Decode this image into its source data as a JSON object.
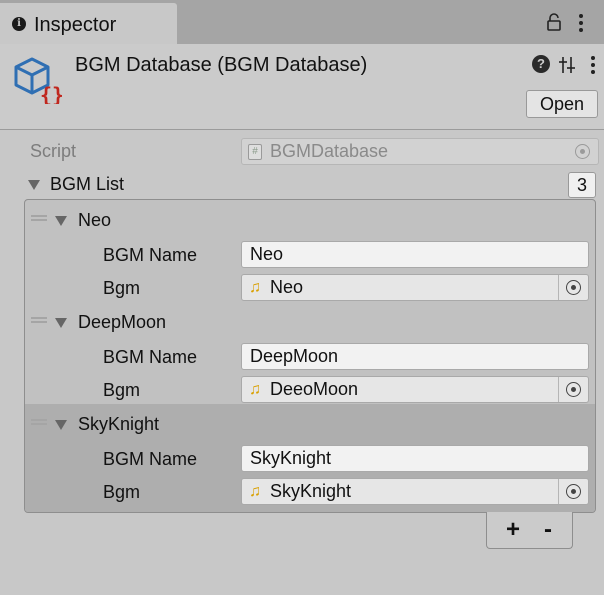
{
  "tab": {
    "title": "Inspector",
    "info_icon": "info-icon",
    "lock_icon": "lock-icon",
    "menu_icon": "kebab-menu-icon"
  },
  "header": {
    "title": "BGM Database (BGM Database)",
    "asset_icon": "scriptable-object-icon",
    "help_icon": "help-icon",
    "help_glyph": "?",
    "presets_icon": "presets-icon",
    "menu_icon": "kebab-menu-icon",
    "open_label": "Open"
  },
  "script": {
    "label": "Script",
    "value": "BGMDatabase",
    "file_glyph": "#"
  },
  "bgm_list": {
    "label": "BGM List",
    "size": "3",
    "items": [
      {
        "header": "Neo",
        "name_label": "BGM Name",
        "name_value": "Neo",
        "bgm_label": "Bgm",
        "bgm_value": "Neo",
        "selected": false
      },
      {
        "header": "DeepMoon",
        "name_label": "BGM Name",
        "name_value": "DeepMoon",
        "bgm_label": "Bgm",
        "bgm_value": "DeeoMoon",
        "selected": false
      },
      {
        "header": "SkyKnight",
        "name_label": "BGM Name",
        "name_value": "SkyKnight",
        "bgm_label": "Bgm",
        "bgm_value": "SkyKnight",
        "selected": true
      }
    ],
    "add_label": "+",
    "remove_label": "-"
  },
  "colors": {
    "tab_strip": "#a5a5a5",
    "panel": "#c8c8c8",
    "list_bg": "#c1c1c1",
    "selected_row": "#aeaeae",
    "audio_icon": "#d9a000",
    "script_icon_blue": "#2f6fb3",
    "script_icon_red": "#c0271e"
  }
}
